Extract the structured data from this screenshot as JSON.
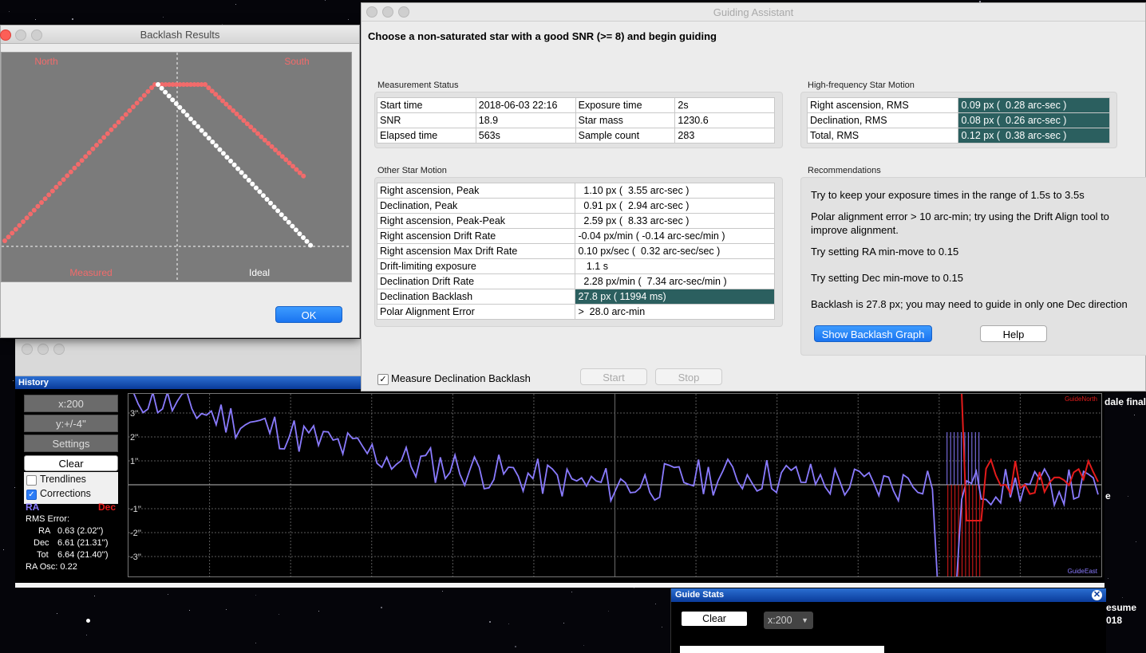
{
  "guiding_assistant": {
    "title": "Guiding Assistant",
    "instruction": "Choose a non-saturated star with a good SNR (>= 8) and begin guiding",
    "measurement_status": {
      "label": "Measurement Status",
      "rows": [
        [
          "Start time",
          "2018-06-03 22:16",
          "Exposure time",
          "2s"
        ],
        [
          "SNR",
          "18.9",
          "Star mass",
          "1230.6"
        ],
        [
          "Elapsed time",
          "563s",
          "Sample count",
          "283"
        ]
      ]
    },
    "high_frequency": {
      "label": "High-frequency Star Motion",
      "rows": [
        [
          "Right ascension, RMS",
          "0.09 px (  0.28 arc-sec )"
        ],
        [
          "Declination, RMS",
          "0.08 px (  0.26 arc-sec )"
        ],
        [
          "Total, RMS",
          "0.12 px (  0.38 arc-sec )"
        ]
      ]
    },
    "other_motion": {
      "label": "Other Star Motion",
      "rows": [
        [
          "Right ascension, Peak",
          "  1.10 px (  3.55 arc-sec )"
        ],
        [
          "Declination, Peak",
          "  0.91 px (  2.94 arc-sec )"
        ],
        [
          "Right ascension, Peak-Peak",
          "  2.59 px (  8.33 arc-sec )"
        ],
        [
          "Right ascension Drift Rate",
          "-0.04 px/min ( -0.14 arc-sec/min )"
        ],
        [
          "Right ascension Max Drift Rate",
          "0.10 px/sec (  0.32 arc-sec/sec )"
        ],
        [
          "Drift-limiting exposure",
          "   1.1 s"
        ],
        [
          "Declination Drift Rate",
          "  2.28 px/min (  7.34 arc-sec/min )"
        ],
        [
          "Declination Backlash",
          "27.8 px ( 11994 ms)"
        ],
        [
          "Polar Alignment Error",
          ">  28.0 arc-min"
        ]
      ]
    },
    "recommendations": {
      "label": "Recommendations",
      "items": [
        "Try to keep your exposure times in the range of 1.5s to 3.5s",
        "Polar alignment error > 10 arc-min; try using the Drift Align tool to improve alignment.",
        "Try setting RA min-move to 0.15",
        "Try setting Dec min-move to 0.15",
        "Backlash is 27.8 px; you may need to guide in only one Dec direction"
      ],
      "show_backlash_label": "Show Backlash Graph",
      "help_label": "Help"
    },
    "measure_dec_backlash_label": "Measure Declination Backlash",
    "measure_dec_backlash_checked": true,
    "start_label": "Start",
    "stop_label": "Stop"
  },
  "backlash_results": {
    "title": "Backlash Results",
    "north_label": "North",
    "south_label": "South",
    "measured_label": "Measured",
    "ideal_label": "Ideal",
    "ok_label": "OK",
    "colors": {
      "measured": "#f26b6b",
      "ideal": "#ffffff",
      "background": "#7b7b7b"
    }
  },
  "history": {
    "title": "History",
    "x_scale": "x:200",
    "y_scale": "y:+/-4''",
    "settings_label": "Settings",
    "clear_label": "Clear",
    "trendlines_label": "Trendlines",
    "trendlines_checked": false,
    "corrections_label": "Corrections",
    "corrections_checked": true,
    "ra_label": "RA",
    "dec_label": "Dec",
    "rms_error_label": "RMS Error:",
    "rms": [
      {
        "label": "RA",
        "value": "0.63 (2.02'')"
      },
      {
        "label": "Dec",
        "value": "6.61 (21.31'')"
      },
      {
        "label": "Tot",
        "value": "6.64 (21.40'')"
      }
    ],
    "ra_osc": "RA Osc: 0.22",
    "y_ticks": [
      "3''",
      "2''",
      "1''",
      "-1''",
      "-2''",
      "-3''"
    ],
    "guide_north_label": "GuideNorth",
    "guide_east_label": "GuideEast",
    "colors": {
      "ra": "#8a7bff",
      "dec": "#e31b1b"
    }
  },
  "guide_stats": {
    "title": "Guide Stats",
    "clear_label": "Clear",
    "x_scale": "x:200"
  },
  "background_text": {
    "right_top": "dale final",
    "right_mid": "e",
    "resume": "esume",
    "year": "018"
  }
}
